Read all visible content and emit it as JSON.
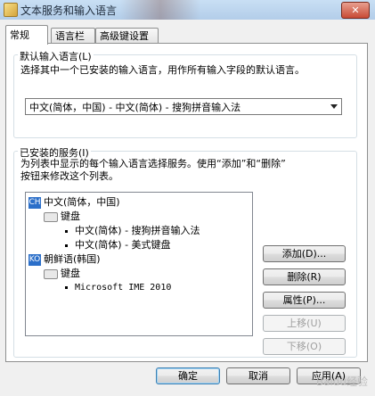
{
  "window": {
    "title": "文本服务和输入语言",
    "close_label": "✕"
  },
  "tabs": [
    "常规",
    "语言栏",
    "高级键设置"
  ],
  "default_lang": {
    "label": "默认输入语言(L)",
    "desc": "选择其中一个已安装的输入语言，用作所有输入字段的默认语言。",
    "selected": "中文(简体，中国) - 中文(简体) - 搜狗拼音输入法"
  },
  "installed": {
    "label": "已安装的服务(I)",
    "desc_line1": "为列表中显示的每个输入语言选择服务。使用“添加”和“删除”",
    "desc_line2": "按钮来修改这个列表。",
    "tree": {
      "lang1_badge": "CH",
      "lang1": "中文(简体，中国)",
      "lang1_keyboard": "键盘",
      "lang1_items": [
        "中文(简体) - 搜狗拼音输入法",
        "中文(简体) - 美式键盘"
      ],
      "lang2_badge": "KO",
      "lang2": "朝鲜语(韩国)",
      "lang2_keyboard": "键盘",
      "lang2_items": [
        "Microsoft IME 2010"
      ]
    },
    "buttons": {
      "add": "添加(D)...",
      "remove": "删除(R)",
      "properties": "属性(P)...",
      "move_up": "上移(U)",
      "move_down": "下移(O)"
    }
  },
  "footer": {
    "ok": "确定",
    "cancel": "取消",
    "apply": "应用(A)"
  },
  "watermark": "Baidu经验"
}
